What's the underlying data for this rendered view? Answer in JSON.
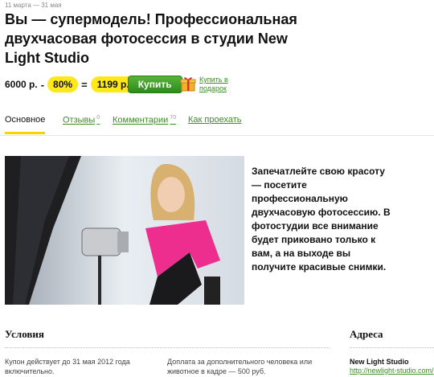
{
  "deal": {
    "dates": "11 марта — 31 мая",
    "title": "Вы — супермодель! Профессиональная двухчасовая фотосессия в студии New Light Studio",
    "original_price": "6000 р.",
    "minus": "-",
    "discount": "80%",
    "equals": "=",
    "price": "1199 р.",
    "buy_label": "Купить",
    "gift_label": "Купить в подарок",
    "gift_icon": "gift-icon"
  },
  "tabs": [
    {
      "label": "Основное",
      "count": ""
    },
    {
      "label": "Отзывы",
      "count": "0"
    },
    {
      "label": "Комментарии",
      "count": "70"
    },
    {
      "label": "Как проехать",
      "count": ""
    }
  ],
  "description": "Запечатлейте свою красоту — посетите профессиональную двухчасовую фотосессию. В фотостудии все внимание будет приковано только к вам, а на выходе вы получите красивые снимки.",
  "conditions": {
    "title": "Условия",
    "items": [
      "Купон действует до 31 мая 2012 года включительно.",
      "Доплата за дополнительного человека или животное в кадре — 500 руб."
    ]
  },
  "addresses": {
    "title": "Адреса",
    "name": "New Light Studio",
    "link": "http://newlight-studio.com/"
  },
  "colors": {
    "accent_yellow": "#ffe81a",
    "buy_green": "#3c9a24",
    "link_green": "#3a8f1f"
  }
}
